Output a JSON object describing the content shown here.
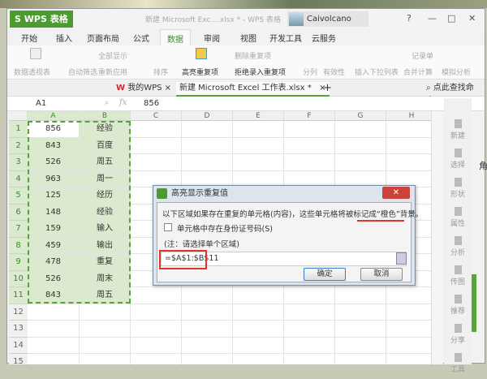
{
  "window": {
    "app_button": "S WPS 表格",
    "title": "新建 Microsoft Exc....xlsx * - WPS 表格",
    "user": "Caivolcano",
    "controls": [
      "?",
      "—",
      "□",
      "✕"
    ]
  },
  "menu_tabs": [
    "开始",
    "插入",
    "页面布局",
    "公式",
    "数据",
    "审阅",
    "视图",
    "开发工具",
    "云服务"
  ],
  "active_tab": "数据",
  "ribbon": {
    "pivot": "数据透视表",
    "autofilter": "自动筛选",
    "show_all": "全部显示",
    "reapply": "重新应用",
    "sort": "排序",
    "highlight_dup": "高亮重复项",
    "remove_dup": "删除重复项",
    "reject_dup": "拒绝录入重复项",
    "split": "分列",
    "validity": "有效性",
    "dropdown": "插入下拉列表",
    "records": "记录单",
    "consolidate": "合并计算",
    "whatif": "模拟分析"
  },
  "doc_tabs": {
    "mywps": "我的WPS",
    "file": "新建 Microsoft Excel 工作表.xlsx *",
    "search": "点此查找命令"
  },
  "formula_bar": {
    "cell_ref": "A1",
    "fx": "fx",
    "value": "856"
  },
  "columns": [
    "A",
    "B",
    "C",
    "D",
    "E",
    "F",
    "G",
    "H"
  ],
  "rows": [
    [
      "856",
      "经验"
    ],
    [
      "843",
      "百度"
    ],
    [
      "526",
      "周五"
    ],
    [
      "963",
      "周一"
    ],
    [
      "125",
      "经历"
    ],
    [
      "148",
      "经验"
    ],
    [
      "159",
      "输入"
    ],
    [
      "459",
      "输出"
    ],
    [
      "478",
      "重复"
    ],
    [
      "526",
      "周末"
    ],
    [
      "843",
      "周五"
    ]
  ],
  "sidebar": [
    "新建",
    "选择",
    "形状",
    "属性",
    "分析",
    "传图",
    "推荐",
    "分享",
    "工具"
  ],
  "stray_text": "角",
  "dialog": {
    "title": "高亮显示重复值",
    "close": "✕",
    "message": "以下区域如果存在重复的单元格(内容)，这些单元格将被标记成“橙色”背景。",
    "checkbox_label": "单元格中存在身份证号码(S)",
    "checkbox_checked": false,
    "note": "(注：请选择单个区域)",
    "range": "=$A$1:$B$11",
    "ok": "确定",
    "cancel": "取消"
  },
  "colors": {
    "accent": "#4c9b2f",
    "selection": "#dbe9cf",
    "highlight": "#dd3333"
  }
}
